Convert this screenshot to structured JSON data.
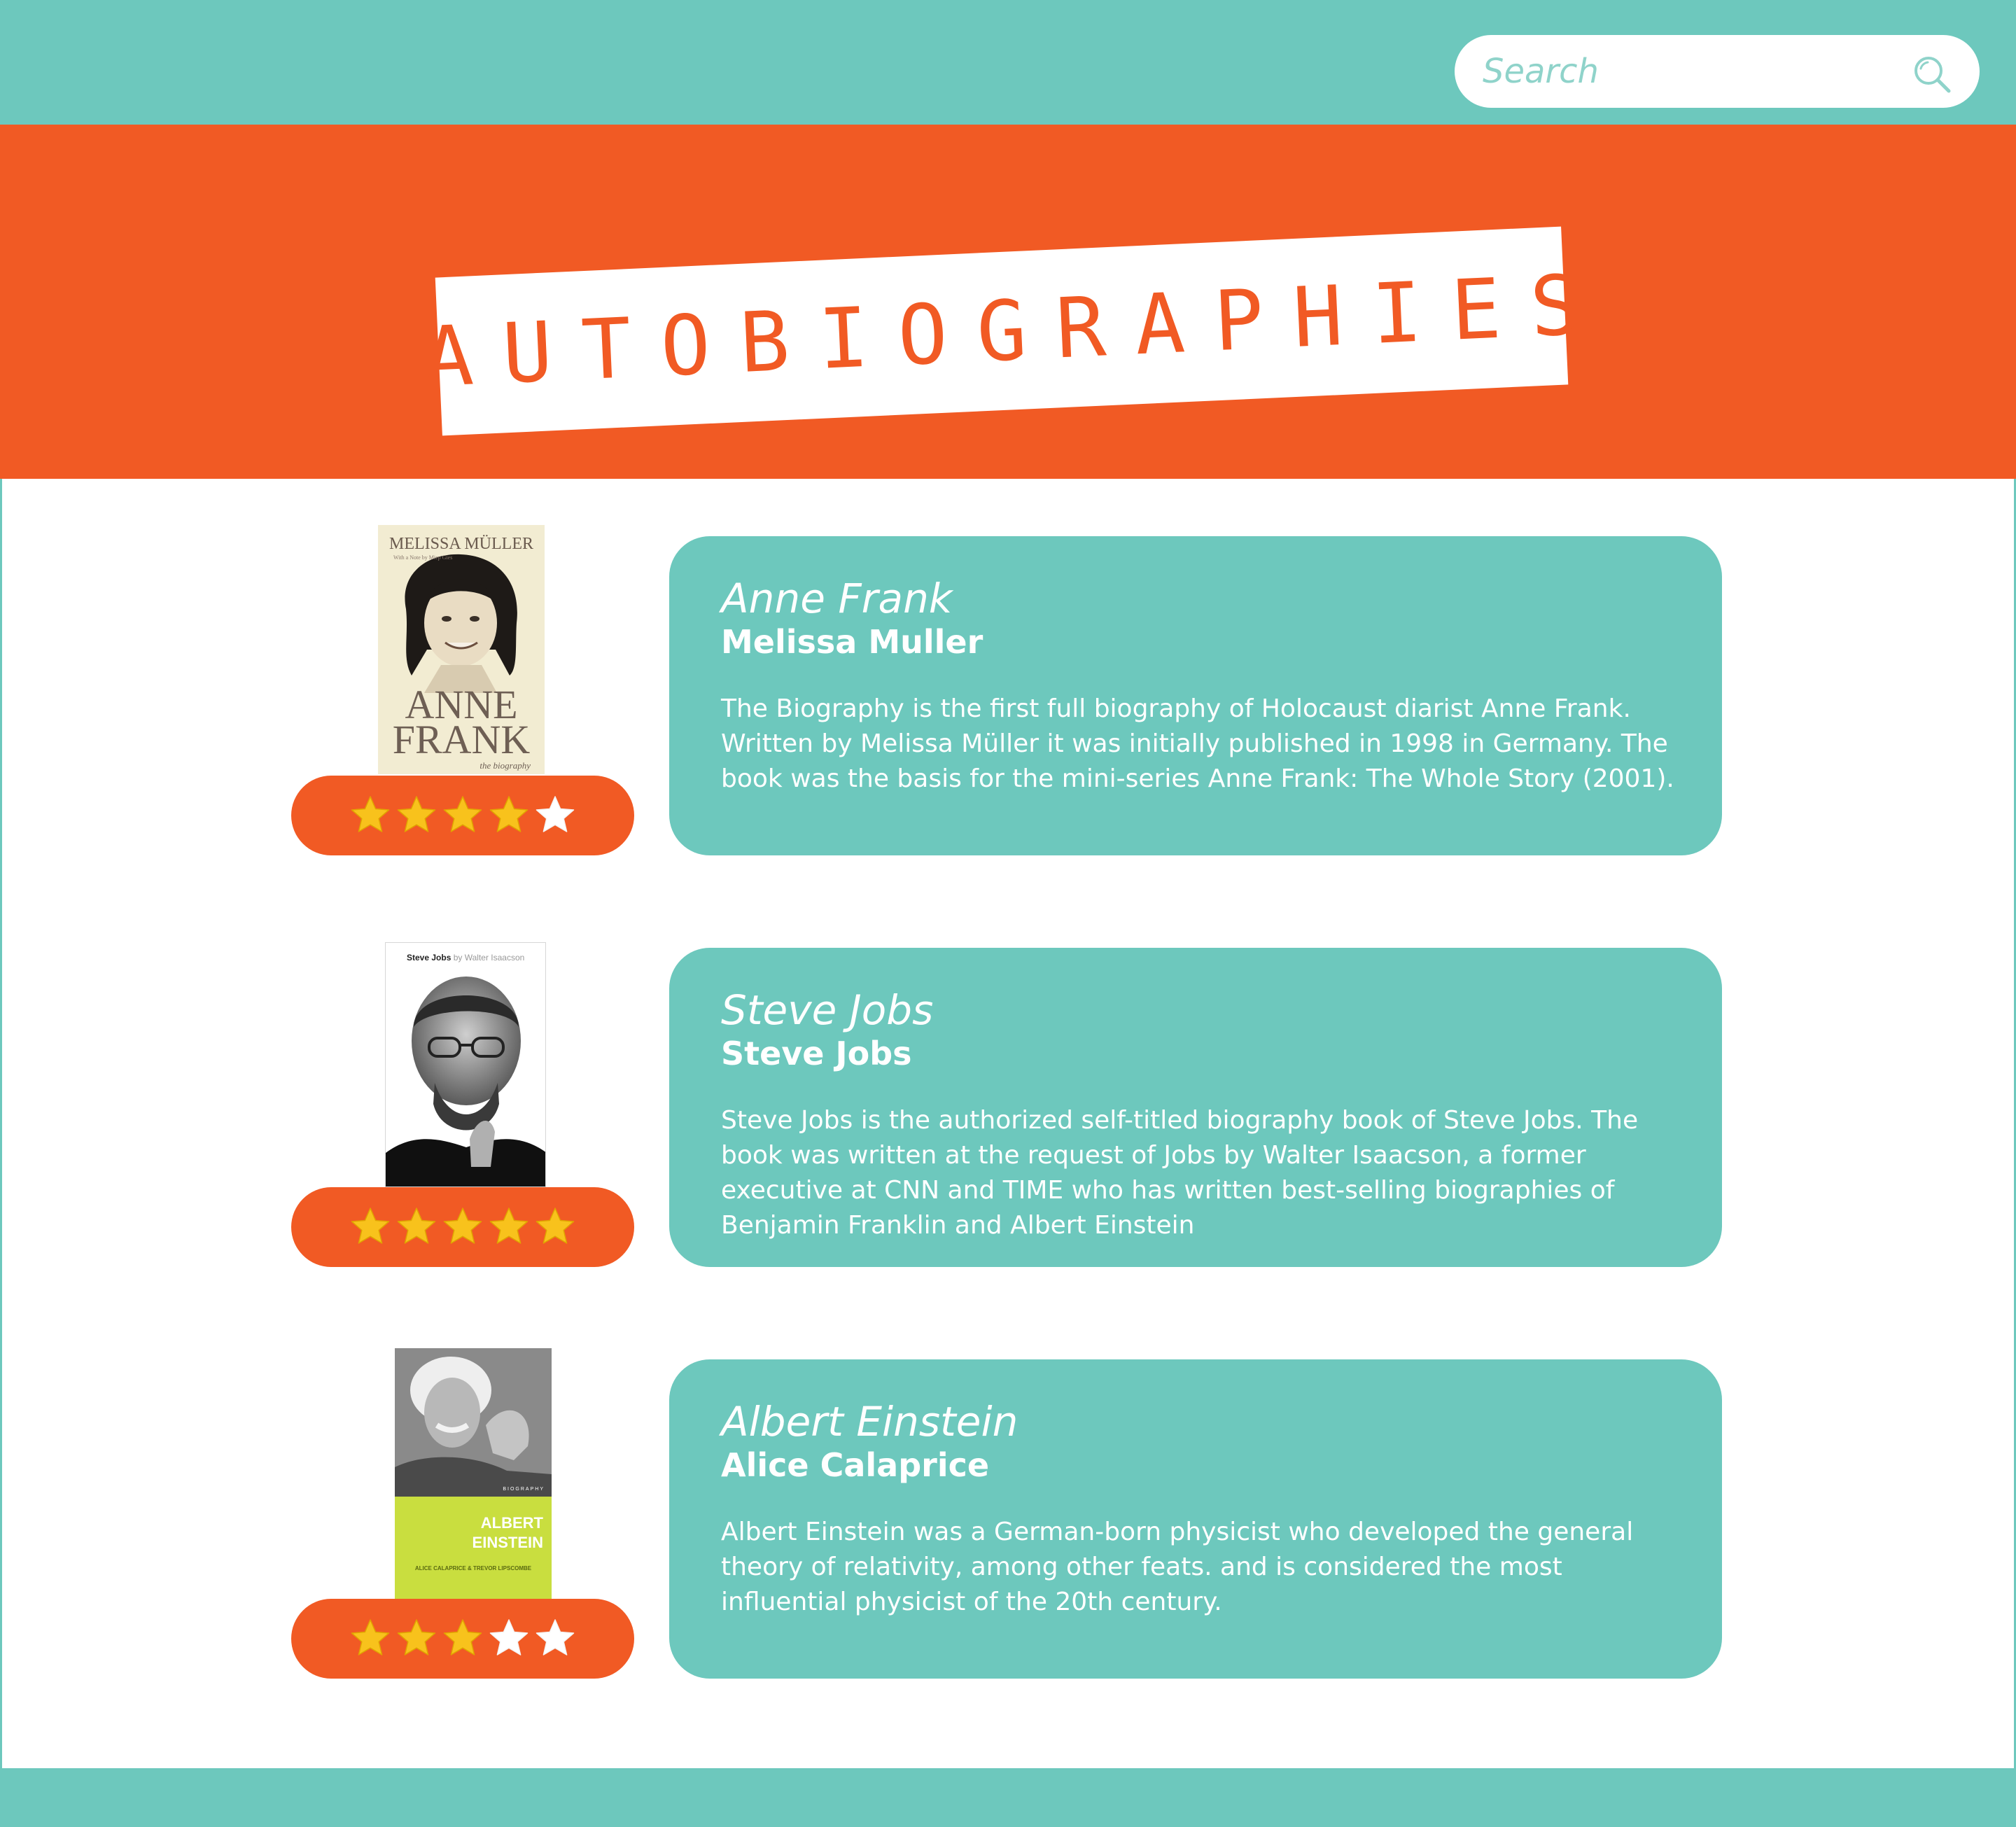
{
  "search": {
    "placeholder": "Search",
    "icon": "search-icon"
  },
  "banner": {
    "title": "AUTOBIOGRAPHIES"
  },
  "colors": {
    "teal": "#6dc8bd",
    "orange": "#f15a24",
    "star_gold": "#f8c21c",
    "white": "#ffffff"
  },
  "books": [
    {
      "title": "Anne Frank",
      "author": "Melissa Muller",
      "description": "The Biography is the first full biography of Holocaust diarist Anne Frank. Written by Melissa Müller it was initially published in 1998 in Germany. The book was the basis for the mini-series Anne Frank: The Whole Story (2001).",
      "rating": 4,
      "rating_max": 5,
      "cover": {
        "top_text": "MELISSA MÜLLER",
        "note_text": "With a Note by Miep Gies",
        "title_line1": "ANNE",
        "title_line2": "FRANK",
        "subtitle": "the biography"
      }
    },
    {
      "title": "Steve Jobs",
      "author": "Steve Jobs",
      "description": "Steve Jobs is the authorized self-titled biography book of Steve Jobs. The book was written at the request of Jobs by Walter Isaacson, a former executive at CNN and TIME who has written best-selling biographies of Benjamin Franklin and Albert Einstein",
      "rating": 5,
      "rating_max": 5,
      "cover": {
        "header_bold": "Steve Jobs",
        "header_rest": " by Walter Isaacson"
      }
    },
    {
      "title": "Albert Einstein",
      "author": "Alice Calaprice",
      "description": "Albert Einstein was a German-born physicist who developed the general theory of relativity, among other feats. and is considered the most influential physicist of the 20th century.",
      "rating": 3,
      "rating_max": 5,
      "cover": {
        "label": "BIOGRAPHY",
        "title_line1": "ALBERT",
        "title_line2": "EINSTEIN",
        "authors": "ALICE CALAPRICE & TREVOR LIPSCOMBE"
      }
    }
  ]
}
